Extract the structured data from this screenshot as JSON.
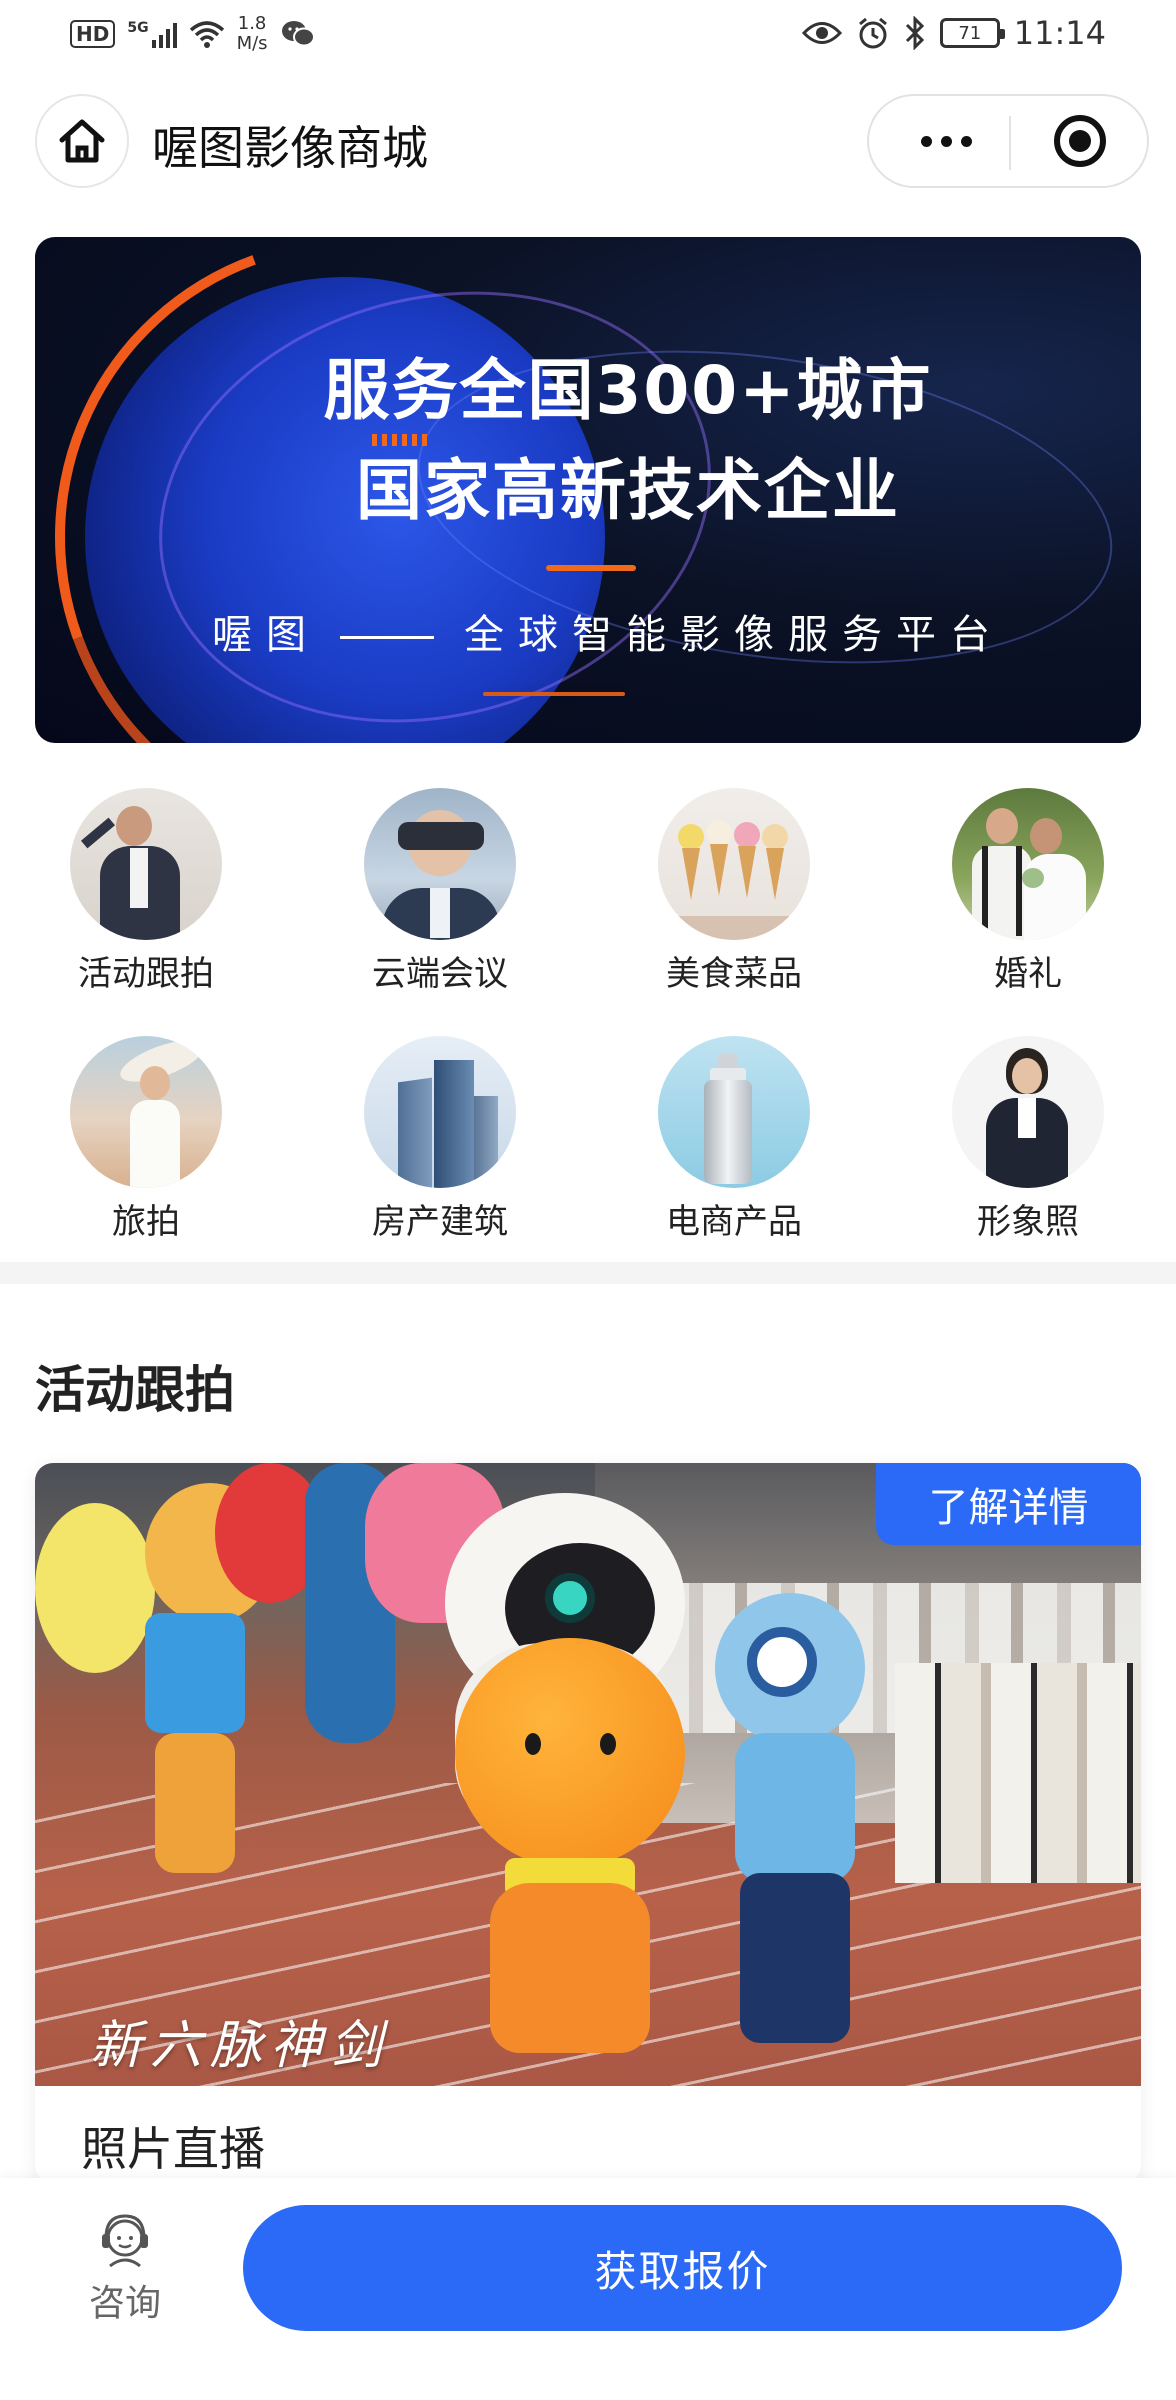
{
  "status_bar": {
    "hd": "HD",
    "network": "5G",
    "speed_value": "1.8",
    "speed_unit": "M/s",
    "battery": "71",
    "time": "11:14"
  },
  "nav": {
    "title": "喔图影像商城"
  },
  "banner": {
    "line1": "服务全国300+城市",
    "line2": "国家高新技术企业",
    "brand": "喔图",
    "tagline": "全球智能影像服务平台"
  },
  "categories": [
    {
      "label": "活动跟拍"
    },
    {
      "label": "云端会议"
    },
    {
      "label": "美食菜品"
    },
    {
      "label": "婚礼"
    },
    {
      "label": "旅拍"
    },
    {
      "label": "房产建筑"
    },
    {
      "label": "电商产品"
    },
    {
      "label": "形象照"
    }
  ],
  "section": {
    "title": "活动跟拍",
    "card": {
      "details_label": "了解详情",
      "watermark": "新六脉神剑",
      "title": "照片直播"
    }
  },
  "bottom_bar": {
    "consult_label": "咨询",
    "quote_label": "获取报价"
  },
  "colors": {
    "accent": "#2b6af7",
    "banner_orange": "#f06a1a",
    "banner_blue": "#1a3bc4"
  }
}
